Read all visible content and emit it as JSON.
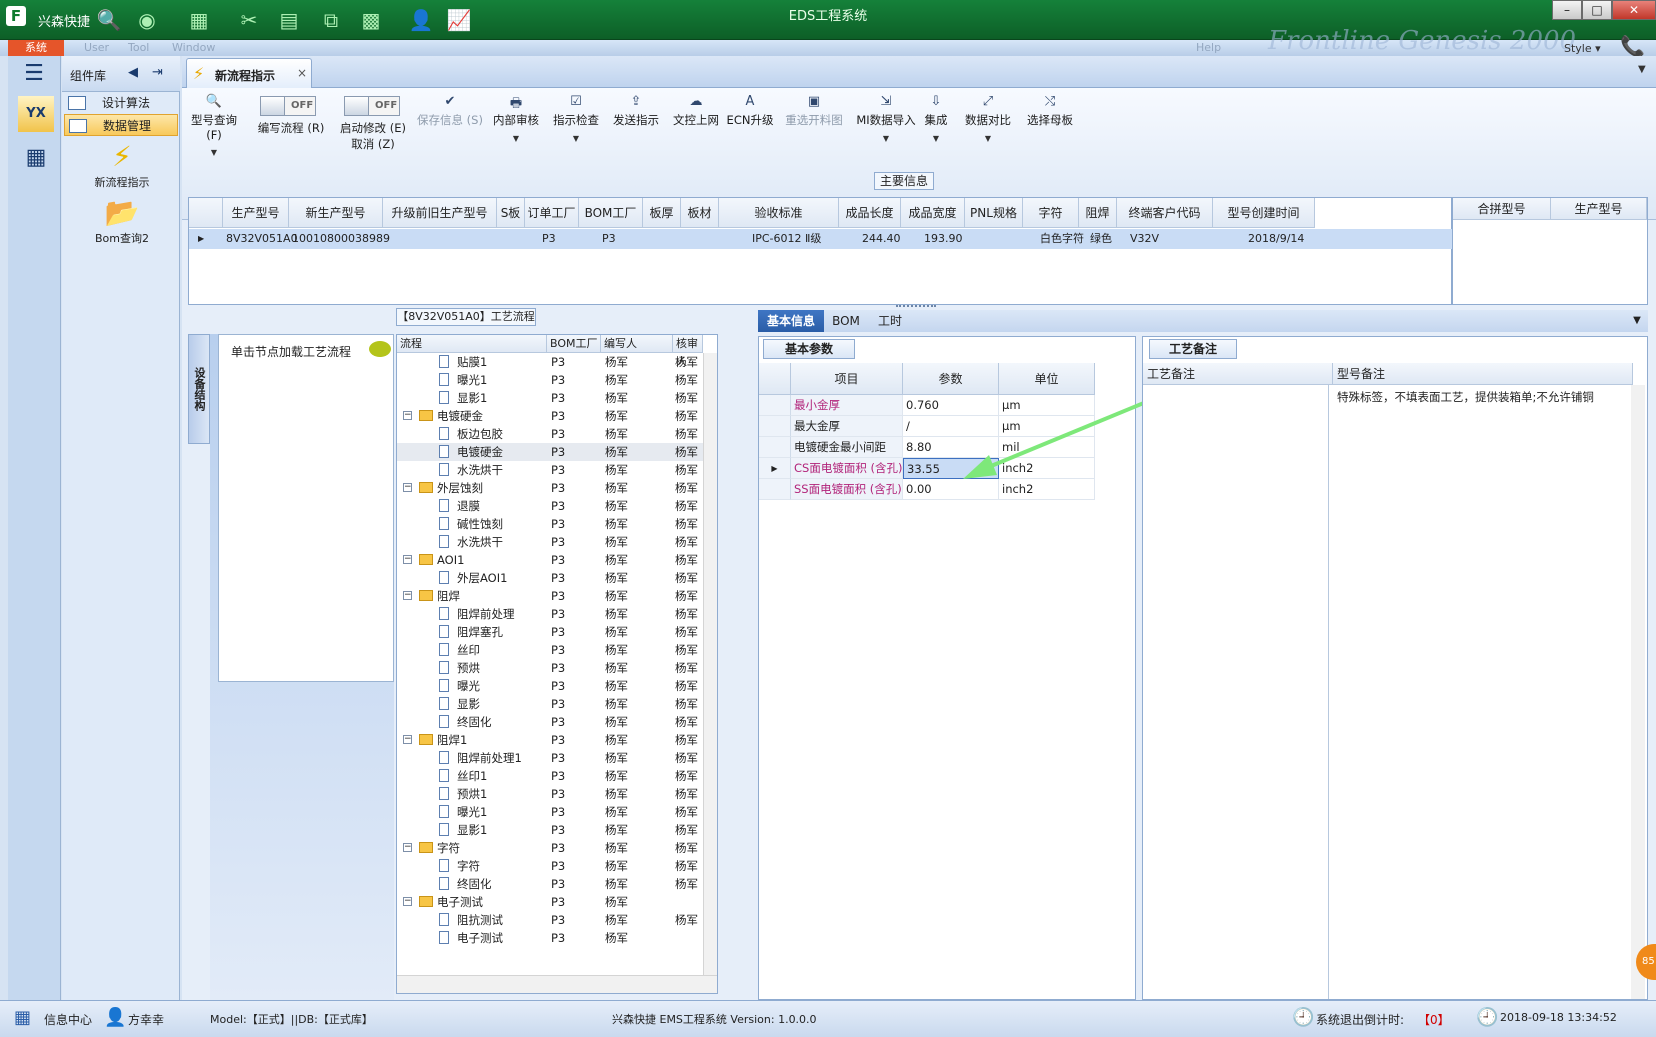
{
  "window": {
    "app_name": "兴森快捷",
    "caption": "EDS工程系统",
    "logo": "F",
    "brand": "Frontline Genesis 2000",
    "style_label": "Style ▾"
  },
  "window_buttons": {
    "minimize": "–",
    "maximize": "□",
    "close": "✕"
  },
  "menu": {
    "system": "系统",
    "user": "User",
    "tool": "Tool",
    "window": "Window",
    "help": "Help"
  },
  "left_strip": {
    "item1": "YX",
    "item2": "▦"
  },
  "library": {
    "title": "组件库",
    "items": [
      {
        "label": "设计算法"
      },
      {
        "label": "数据管理"
      }
    ],
    "big_items": [
      {
        "label": "新流程指示",
        "icon": "⚡"
      },
      {
        "label": "Bom查询2",
        "icon": "📂"
      }
    ]
  },
  "doc_tab": {
    "label": "新流程指示",
    "close": "×"
  },
  "ribbon": {
    "query": "型号查询 (F)",
    "toggle1": {
      "value": "OFF",
      "label": "编写流程 (R)"
    },
    "toggle2": {
      "value": "OFF",
      "label": "启动修改 (E)",
      "sub": "取消 (Z)"
    },
    "buttons": [
      {
        "label": "保存信息 (S)",
        "icon": "✔"
      },
      {
        "label": "内部审核",
        "icon": "🖶"
      },
      {
        "label": "指示检查",
        "icon": "☑"
      },
      {
        "label": "发送指示",
        "icon": "⇪"
      },
      {
        "label": "文控上网",
        "icon": "☁"
      },
      {
        "label": "ECN升级",
        "icon": "A"
      },
      {
        "label": "重选开料图",
        "icon": "▣"
      },
      {
        "label": "MI数据导入",
        "icon": "⇲"
      },
      {
        "label": "集成",
        "icon": "⇩"
      },
      {
        "label": "数据对比",
        "icon": "⤢"
      },
      {
        "label": "选择母板",
        "icon": "⤭"
      }
    ],
    "dropdown": "▼"
  },
  "main_info": {
    "title": "主要信息",
    "columns": [
      "生产型号",
      "新生产型号",
      "升级前旧生产型号",
      "S板",
      "订单工厂",
      "BOM工厂",
      "板厚",
      "板材",
      "验收标准",
      "成品长度",
      "成品宽度",
      "PNL规格",
      "字符",
      "阻焊",
      "终端客户代码",
      "型号创建时间"
    ],
    "row": [
      "8V32V051A0",
      "10010800038989",
      "",
      "",
      "P3",
      "P3",
      "",
      "",
      "IPC-6012 Ⅱ级",
      "244.40",
      "193.90",
      "",
      "白色字符",
      "绿色",
      "V32V",
      "2018/9/14"
    ],
    "sub_columns": [
      "合拼型号",
      "生产型号"
    ]
  },
  "process_panel": {
    "title": "【8V32V051A0】工艺流程",
    "side_label": "设备结构",
    "hint": "单击节点加载工艺流程",
    "columns": [
      "流程",
      "BOM工厂",
      "编写人",
      "核审人"
    ],
    "rows": [
      {
        "lvl": 2,
        "type": "doc",
        "name": "贴膜1",
        "bom": "P3",
        "writer": "杨军",
        "checker": "杨军"
      },
      {
        "lvl": 2,
        "type": "doc",
        "name": "曝光1",
        "bom": "P3",
        "writer": "杨军",
        "checker": "杨军"
      },
      {
        "lvl": 2,
        "type": "doc",
        "name": "显影1",
        "bom": "P3",
        "writer": "杨军",
        "checker": "杨军"
      },
      {
        "lvl": 1,
        "type": "folder",
        "name": "电镀硬金",
        "bom": "P3",
        "writer": "杨军",
        "checker": "杨军"
      },
      {
        "lvl": 2,
        "type": "doc",
        "name": "板边包胶",
        "bom": "P3",
        "writer": "杨军",
        "checker": "杨军"
      },
      {
        "lvl": 2,
        "type": "doc",
        "name": "电镀硬金",
        "bom": "P3",
        "writer": "杨军",
        "checker": "杨军",
        "sel": true
      },
      {
        "lvl": 2,
        "type": "doc",
        "name": "水洗烘干",
        "bom": "P3",
        "writer": "杨军",
        "checker": "杨军"
      },
      {
        "lvl": 1,
        "type": "folder",
        "name": "外层蚀刻",
        "bom": "P3",
        "writer": "杨军",
        "checker": "杨军"
      },
      {
        "lvl": 2,
        "type": "doc",
        "name": "退膜",
        "bom": "P3",
        "writer": "杨军",
        "checker": "杨军"
      },
      {
        "lvl": 2,
        "type": "doc",
        "name": "碱性蚀刻",
        "bom": "P3",
        "writer": "杨军",
        "checker": "杨军"
      },
      {
        "lvl": 2,
        "type": "doc",
        "name": "水洗烘干",
        "bom": "P3",
        "writer": "杨军",
        "checker": "杨军"
      },
      {
        "lvl": 1,
        "type": "folder",
        "name": "AOI1",
        "bom": "P3",
        "writer": "杨军",
        "checker": "杨军"
      },
      {
        "lvl": 2,
        "type": "doc",
        "name": "外层AOI1",
        "bom": "P3",
        "writer": "杨军",
        "checker": "杨军"
      },
      {
        "lvl": 1,
        "type": "folder",
        "name": "阻焊",
        "bom": "P3",
        "writer": "杨军",
        "checker": "杨军"
      },
      {
        "lvl": 2,
        "type": "doc",
        "name": "阻焊前处理",
        "bom": "P3",
        "writer": "杨军",
        "checker": "杨军"
      },
      {
        "lvl": 2,
        "type": "doc",
        "name": "阻焊塞孔",
        "bom": "P3",
        "writer": "杨军",
        "checker": "杨军"
      },
      {
        "lvl": 2,
        "type": "doc",
        "name": "丝印",
        "bom": "P3",
        "writer": "杨军",
        "checker": "杨军"
      },
      {
        "lvl": 2,
        "type": "doc",
        "name": "预烘",
        "bom": "P3",
        "writer": "杨军",
        "checker": "杨军"
      },
      {
        "lvl": 2,
        "type": "doc",
        "name": "曝光",
        "bom": "P3",
        "writer": "杨军",
        "checker": "杨军"
      },
      {
        "lvl": 2,
        "type": "doc",
        "name": "显影",
        "bom": "P3",
        "writer": "杨军",
        "checker": "杨军"
      },
      {
        "lvl": 2,
        "type": "doc",
        "name": "终固化",
        "bom": "P3",
        "writer": "杨军",
        "checker": "杨军"
      },
      {
        "lvl": 1,
        "type": "folder",
        "name": "阻焊1",
        "bom": "P3",
        "writer": "杨军",
        "checker": "杨军"
      },
      {
        "lvl": 2,
        "type": "doc",
        "name": "阻焊前处理1",
        "bom": "P3",
        "writer": "杨军",
        "checker": "杨军"
      },
      {
        "lvl": 2,
        "type": "doc",
        "name": "丝印1",
        "bom": "P3",
        "writer": "杨军",
        "checker": "杨军"
      },
      {
        "lvl": 2,
        "type": "doc",
        "name": "预烘1",
        "bom": "P3",
        "writer": "杨军",
        "checker": "杨军"
      },
      {
        "lvl": 2,
        "type": "doc",
        "name": "曝光1",
        "bom": "P3",
        "writer": "杨军",
        "checker": "杨军"
      },
      {
        "lvl": 2,
        "type": "doc",
        "name": "显影1",
        "bom": "P3",
        "writer": "杨军",
        "checker": "杨军"
      },
      {
        "lvl": 1,
        "type": "folder",
        "name": "字符",
        "bom": "P3",
        "writer": "杨军",
        "checker": "杨军"
      },
      {
        "lvl": 2,
        "type": "doc",
        "name": "字符",
        "bom": "P3",
        "writer": "杨军",
        "checker": "杨军"
      },
      {
        "lvl": 2,
        "type": "doc",
        "name": "终固化",
        "bom": "P3",
        "writer": "杨军",
        "checker": "杨军"
      },
      {
        "lvl": 1,
        "type": "folder",
        "name": "电子测试",
        "bom": "P3",
        "writer": "杨军",
        "checker": ""
      },
      {
        "lvl": 2,
        "type": "doc",
        "name": "阻抗测试",
        "bom": "P3",
        "writer": "杨军",
        "checker": "杨军"
      },
      {
        "lvl": 2,
        "type": "doc",
        "name": "电子测试",
        "bom": "P3",
        "writer": "杨军",
        "checker": ""
      }
    ]
  },
  "detail_tabs": [
    {
      "label": "基本信息",
      "active": true
    },
    {
      "label": "BOM"
    },
    {
      "label": "工时"
    }
  ],
  "basic_params": {
    "title": "基本参数",
    "columns": [
      "项目",
      "参数",
      "单位"
    ],
    "rows": [
      {
        "item": "最小金厚",
        "value": "0.760",
        "unit": "μm",
        "color": "#b2247a"
      },
      {
        "item": "最大金厚",
        "value": "/",
        "unit": "μm",
        "color": "#222222"
      },
      {
        "item": "电镀硬金最小间距",
        "value": "8.80",
        "unit": "mil",
        "color": "#222222"
      },
      {
        "item": "CS面电镀面积 (含孔)",
        "value": "33.55",
        "unit": "inch2",
        "color": "#b2247a",
        "active": true
      },
      {
        "item": "SS面电镀面积 (含孔)",
        "value": "0.00",
        "unit": "inch2",
        "color": "#b2247a"
      }
    ]
  },
  "notes": {
    "title": "工艺备注",
    "col1": "工艺备注",
    "col2": "型号备注",
    "text": "特殊标签，不填表面工艺，提供装箱单;不允许铺铜"
  },
  "status": {
    "info_center": "信息中心",
    "user": "方幸幸",
    "model": "Model:【正式】||DB:【正式库】",
    "version": "兴森快捷 EMS工程系统 Version: 1.0.0.0",
    "countdown": "系统退出倒计时:",
    "countdown_value": "【0】",
    "datetime": "2018-09-18 13:34:52",
    "badge": "85"
  },
  "colors": {
    "titlebar": "#0d6a2c",
    "accent": "#2a5da7",
    "highlight": "#c9dcf5",
    "arrow": "#7ee87a"
  }
}
